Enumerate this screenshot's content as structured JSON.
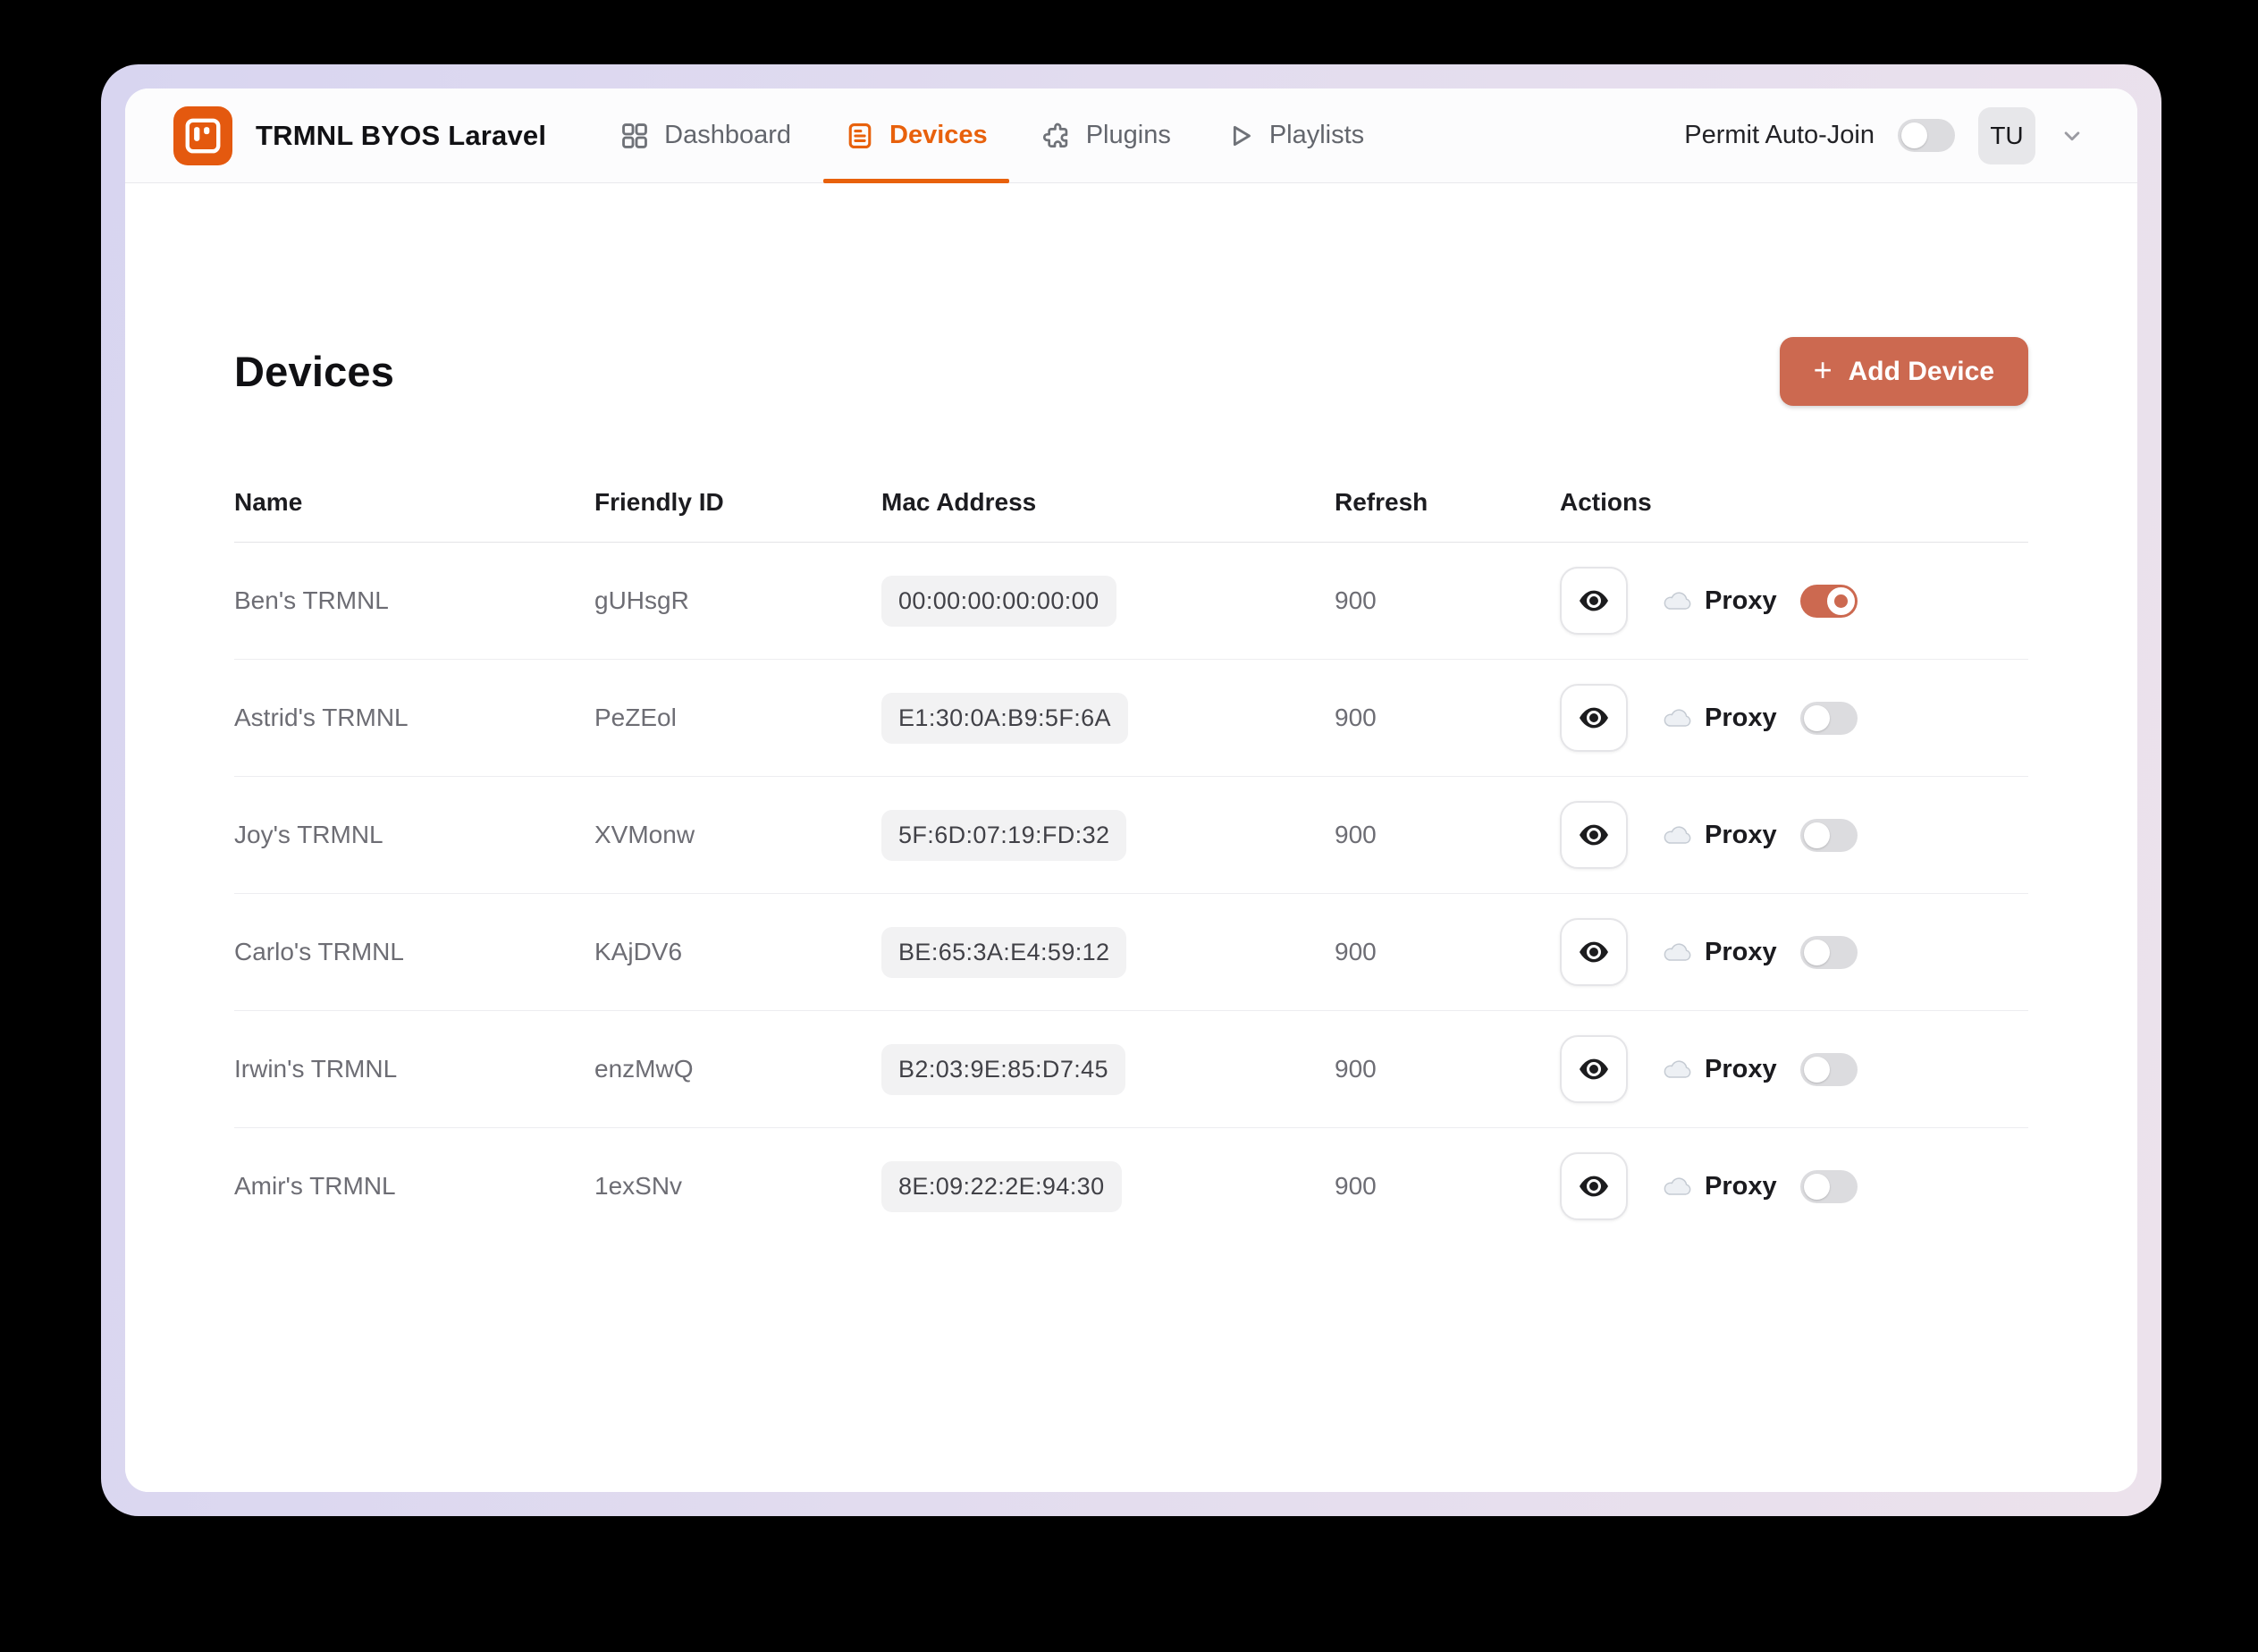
{
  "brand": {
    "title": "TRMNL BYOS Laravel"
  },
  "nav": {
    "items": [
      {
        "label": "Dashboard",
        "icon": "grid-icon",
        "active": false
      },
      {
        "label": "Devices",
        "icon": "document-lines-icon",
        "active": true
      },
      {
        "label": "Plugins",
        "icon": "puzzle-icon",
        "active": false
      },
      {
        "label": "Playlists",
        "icon": "play-icon",
        "active": false
      }
    ]
  },
  "header_right": {
    "permit_label": "Permit Auto-Join",
    "permit_on": false,
    "avatar_initials": "TU"
  },
  "page": {
    "title": "Devices",
    "add_button_label": "Add Device",
    "add_button_plus": "+"
  },
  "table": {
    "columns": [
      "Name",
      "Friendly ID",
      "Mac Address",
      "Refresh",
      "Actions"
    ],
    "proxy_label": "Proxy",
    "rows": [
      {
        "name": "Ben's TRMNL",
        "friendly_id": "gUHsgR",
        "mac": "00:00:00:00:00:00",
        "refresh": "900",
        "proxy_on": true
      },
      {
        "name": "Astrid's TRMNL",
        "friendly_id": "PeZEol",
        "mac": "E1:30:0A:B9:5F:6A",
        "refresh": "900",
        "proxy_on": false
      },
      {
        "name": "Joy's TRMNL",
        "friendly_id": "XVMonw",
        "mac": "5F:6D:07:19:FD:32",
        "refresh": "900",
        "proxy_on": false
      },
      {
        "name": "Carlo's TRMNL",
        "friendly_id": "KAjDV6",
        "mac": "BE:65:3A:E4:59:12",
        "refresh": "900",
        "proxy_on": false
      },
      {
        "name": "Irwin's TRMNL",
        "friendly_id": "enzMwQ",
        "mac": "B2:03:9E:85:D7:45",
        "refresh": "900",
        "proxy_on": false
      },
      {
        "name": "Amir's TRMNL",
        "friendly_id": "1exSNv",
        "mac": "8E:09:22:2E:94:30",
        "refresh": "900",
        "proxy_on": false
      }
    ]
  },
  "colors": {
    "accent_orange": "#e8610c",
    "logo_orange": "#e4590f",
    "button_salmon": "#cc6950",
    "toggle_on": "#cc6950",
    "frame_gradient_start": "#d8d5f0",
    "frame_gradient_end": "#ece2ec"
  }
}
